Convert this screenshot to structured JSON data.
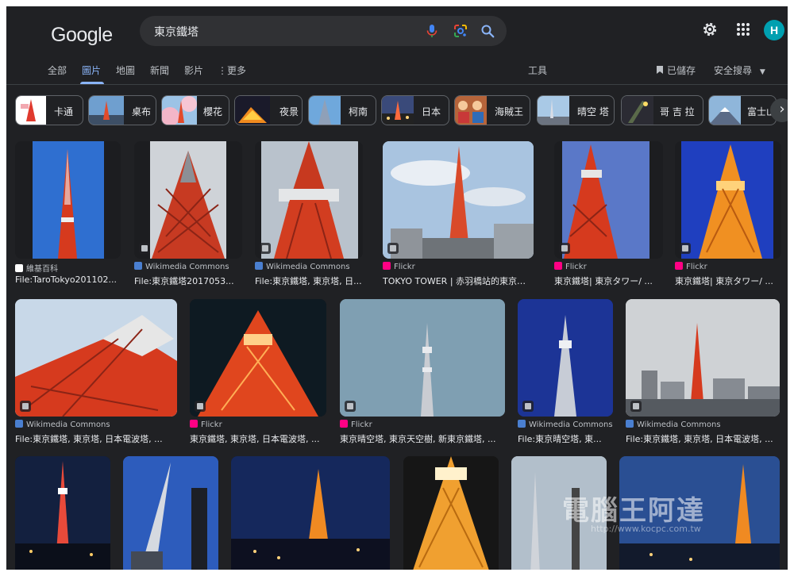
{
  "header": {
    "logo": "Google",
    "search_query": "東京鐵塔",
    "avatar_initial": "H"
  },
  "tabs": [
    "全部",
    "圖片",
    "地圖",
    "新聞",
    "影片",
    "更多"
  ],
  "tools_label": "工具",
  "saved_label": "已儲存",
  "safesearch_label": "安全搜尋",
  "chips": [
    "卡通",
    "桌布",
    "櫻花",
    "夜景",
    "柯南",
    "日本",
    "海賊王",
    "晴空 塔",
    "哥 吉 拉",
    "富士山"
  ],
  "results_row1": [
    {
      "source": "維基百科",
      "title": "File:TaroTokyo201102..."
    },
    {
      "source": "Wikimedia Commons",
      "title": "File:東京鐵塔2017053..."
    },
    {
      "source": "Wikimedia Commons",
      "title": "File:東京鐵塔, 東京塔, 日..."
    },
    {
      "source": "Flickr",
      "title": "TOKYO TOWER | 赤羽橋站的東京鐵..."
    },
    {
      "source": "Flickr",
      "title": "東京鐵塔| 東京タワー/ ..."
    },
    {
      "source": "Flickr",
      "title": "東京鐵塔| 東京タワー/ ..."
    }
  ],
  "results_row2": [
    {
      "source": "Wikimedia Commons",
      "title": "File:東京鐵塔, 東京塔, 日本電波塔, ..."
    },
    {
      "source": "Flickr",
      "title": "東京鐵塔, 東京塔, 日本電波塔, ..."
    },
    {
      "source": "Flickr",
      "title": "東京晴空塔, 東京天空樹, 新東京鐵塔, ..."
    },
    {
      "source": "Wikimedia Commons",
      "title": "File:東京晴空塔, 東..."
    },
    {
      "source": "Wikimedia Commons",
      "title": "File:東京鐵塔, 東京塔, 日本電波塔, ..."
    }
  ],
  "watermark": "電腦王阿達",
  "watermark_url": "http://www.kocpc.com.tw",
  "colors": {
    "background": "#202124",
    "accent": "#8ab4f8",
    "tower_red": "#d63a1e",
    "avatar": "#00a0b0"
  }
}
